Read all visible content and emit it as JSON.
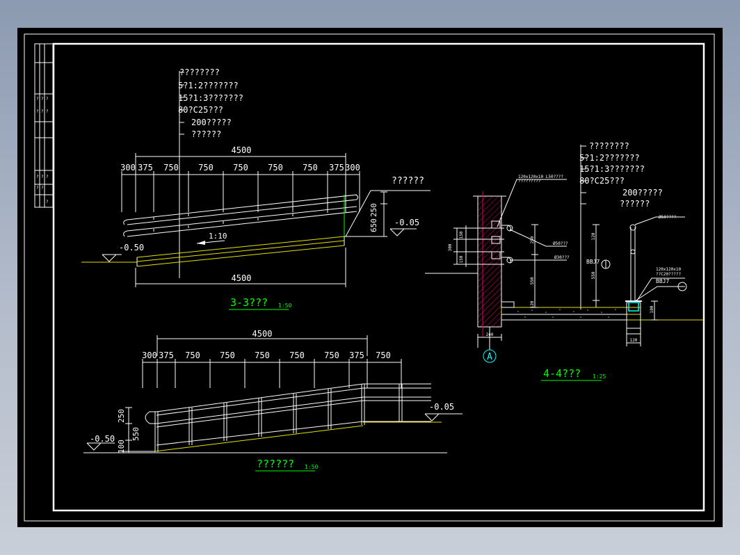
{
  "section_3_3": {
    "notes": [
      "????????",
      "5?1:2???????",
      "15?1:3???????",
      "80?C25???",
      "200?????",
      "??????"
    ],
    "overall_dim_top": "4500",
    "spacing_dims": [
      "300",
      "375",
      "750",
      "750",
      "750",
      "750",
      "750",
      "375",
      "300"
    ],
    "overall_dim_bottom": "4500",
    "slope_label": "1:10",
    "level_left": "-0.50",
    "level_right": "-0.05",
    "height_dims": [
      "250",
      "650"
    ],
    "callout": "??????",
    "title": "3-3???",
    "scale": "1:50"
  },
  "railing_elevation": {
    "overall_dim": "4500",
    "spacing_dims": [
      "300",
      "375",
      "750",
      "750",
      "750",
      "750",
      "750",
      "375",
      "750"
    ],
    "height_dims": [
      "250",
      "550",
      "100"
    ],
    "level_left": "-0.50",
    "level_right": "-0.05",
    "title": "??????",
    "scale": "1:50"
  },
  "section_4_4": {
    "notes": [
      "????????",
      "5?1:2???????",
      "15?1:3???????",
      "80?C25???",
      "200?????",
      "??????"
    ],
    "leader_top": "120x120x10 L50????",
    "leader_top_2": "?????????",
    "leader_mid": "Ø50???",
    "leader_low": "Ø30???",
    "pipe_label": "Ø50????",
    "bolt_labels": [
      "BBJ7",
      "BBJ7"
    ],
    "base_label_1": "120x120x10",
    "base_label_2": "??C20?????",
    "dim_labels": [
      "300",
      "150",
      "150",
      "250",
      "550",
      "120",
      "120",
      "240",
      "550",
      "100",
      "120"
    ],
    "axis_label": "A",
    "title": "4-4???",
    "scale": "1:25"
  },
  "title_block": {
    "cells": [
      "?",
      "?",
      "?",
      "?",
      "?",
      "?",
      "?",
      "?",
      "?",
      "?",
      "?",
      "?"
    ]
  }
}
